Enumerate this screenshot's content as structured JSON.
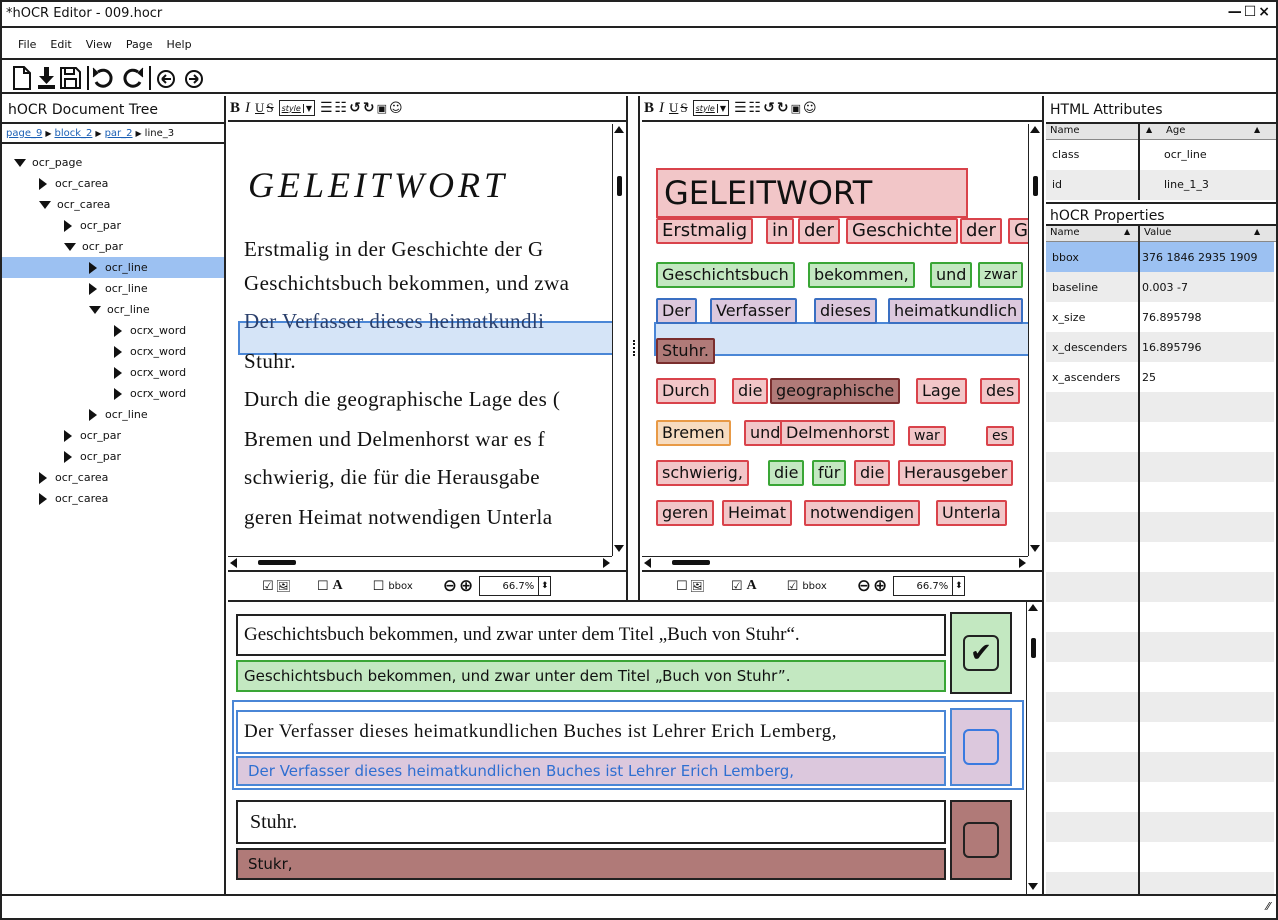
{
  "window": {
    "title": "*hOCR Editor - 009.hocr",
    "controls": [
      "—",
      "☐",
      "×"
    ]
  },
  "menu": [
    {
      "label": "File"
    },
    {
      "label": "Edit"
    },
    {
      "label": "View"
    },
    {
      "label": "Page"
    },
    {
      "label": "Help"
    }
  ],
  "toolbar": {
    "icons": [
      "new-file-icon",
      "download-icon",
      "save-icon",
      "undo-icon",
      "redo-icon",
      "prev-icon",
      "next-icon"
    ]
  },
  "tree": {
    "title": "hOCR Document Tree",
    "breadcrumb": [
      "page_9",
      "block_2",
      "par_2",
      "line_3"
    ],
    "items": [
      {
        "label": "ocr_page",
        "depth": 0,
        "open": true
      },
      {
        "label": "ocr_carea",
        "depth": 1,
        "open": false
      },
      {
        "label": "ocr_carea",
        "depth": 1,
        "open": true
      },
      {
        "label": "ocr_par",
        "depth": 2,
        "open": false
      },
      {
        "label": "ocr_par",
        "depth": 2,
        "open": true
      },
      {
        "label": "ocr_line",
        "depth": 3,
        "open": false,
        "selected": true
      },
      {
        "label": "ocr_line",
        "depth": 3,
        "open": false
      },
      {
        "label": "ocr_line",
        "depth": 3,
        "open": true
      },
      {
        "label": "ocrx_word",
        "depth": 4,
        "open": false
      },
      {
        "label": "ocrx_word",
        "depth": 4,
        "open": false
      },
      {
        "label": "ocrx_word",
        "depth": 4,
        "open": false
      },
      {
        "label": "ocrx_word",
        "depth": 4,
        "open": false
      },
      {
        "label": "ocr_line",
        "depth": 3,
        "open": false
      },
      {
        "label": "ocr_par",
        "depth": 2,
        "open": false
      },
      {
        "label": "ocr_par",
        "depth": 2,
        "open": false
      },
      {
        "label": "ocr_carea",
        "depth": 1,
        "open": false
      },
      {
        "label": "ocr_carea",
        "depth": 1,
        "open": false
      }
    ]
  },
  "editor_toolbar": {
    "style_label": "style"
  },
  "scan_view": {
    "heading": "GELEITWORT",
    "lines": [
      "Erstmalig in der Geschichte der G",
      "Geschichtsbuch bekommen, und zwa",
      "Der Verfasser dieses heimatkundli",
      "Stuhr.",
      "Durch die geographische Lage des (",
      "Bremen und Delmenhorst war es f",
      "schwierig, die für die Herausgabe",
      "geren Heimat notwendigen Unterla"
    ],
    "footer": {
      "image_checked": true,
      "text_checked": false,
      "bbox_label": "bbox",
      "bbox_checked": false,
      "zoom": "66.7%"
    }
  },
  "ocr_view": {
    "heading": "GELEITWORT",
    "words": [
      [
        "Erstmalig",
        "in",
        "der",
        "Geschichte",
        "der",
        "G"
      ],
      [
        "Geschichtsbuch",
        "bekommen,",
        "und",
        "zwar"
      ],
      [
        "Der",
        "Verfasser",
        "dieses",
        "heimatkundlich"
      ],
      [
        "Stuhr."
      ],
      [
        "Durch",
        "die",
        "geographische",
        "Lage",
        "des"
      ],
      [
        "Bremen",
        "und",
        "Delmenhorst",
        "war",
        "es"
      ],
      [
        "schwierig,",
        "die",
        "für",
        "die",
        "Herausgeber"
      ],
      [
        "geren",
        "Heimat",
        "notwendigen",
        "Unterla"
      ]
    ],
    "footer": {
      "image_checked": false,
      "text_checked": true,
      "bbox_label": "bbox",
      "bbox_checked": true,
      "zoom": "66.7%"
    }
  },
  "compare": [
    {
      "scan": "Geschichtsbuch bekommen, und zwar unter dem Titel „Buch von Stuhr“.",
      "ocr": "Geschichtsbuch bekommen, und zwar unter dem Titel „Buch von Stuhr”.",
      "checked": true
    },
    {
      "scan": "Der Verfasser dieses heimatkundlichen Buches ist Lehrer Erich Lemberg,",
      "ocr": "Der Verfasser dieses heimatkundlichen Buches ist Lehrer Erich Lemberg,",
      "checked": false
    },
    {
      "scan": "Stuhr.",
      "ocr": "Stukr,",
      "checked": false
    }
  ],
  "html_attributes": {
    "title": "HTML Attributes",
    "col_name": "Name",
    "col_value": "Age",
    "rows": [
      {
        "k": "class",
        "v": "ocr_line"
      },
      {
        "k": "id",
        "v": "line_1_3"
      }
    ]
  },
  "hocr_properties": {
    "title": "hOCR Properties",
    "col_name": "Name",
    "col_value": "Value",
    "rows": [
      {
        "k": "bbox",
        "v": "376 1846 2935 1909"
      },
      {
        "k": "baseline",
        "v": "0.003 -7"
      },
      {
        "k": "x_size",
        "v": "76.895798"
      },
      {
        "k": "x_descenders",
        "v": "16.895796"
      },
      {
        "k": "x_ascenders",
        "v": "25"
      }
    ]
  }
}
